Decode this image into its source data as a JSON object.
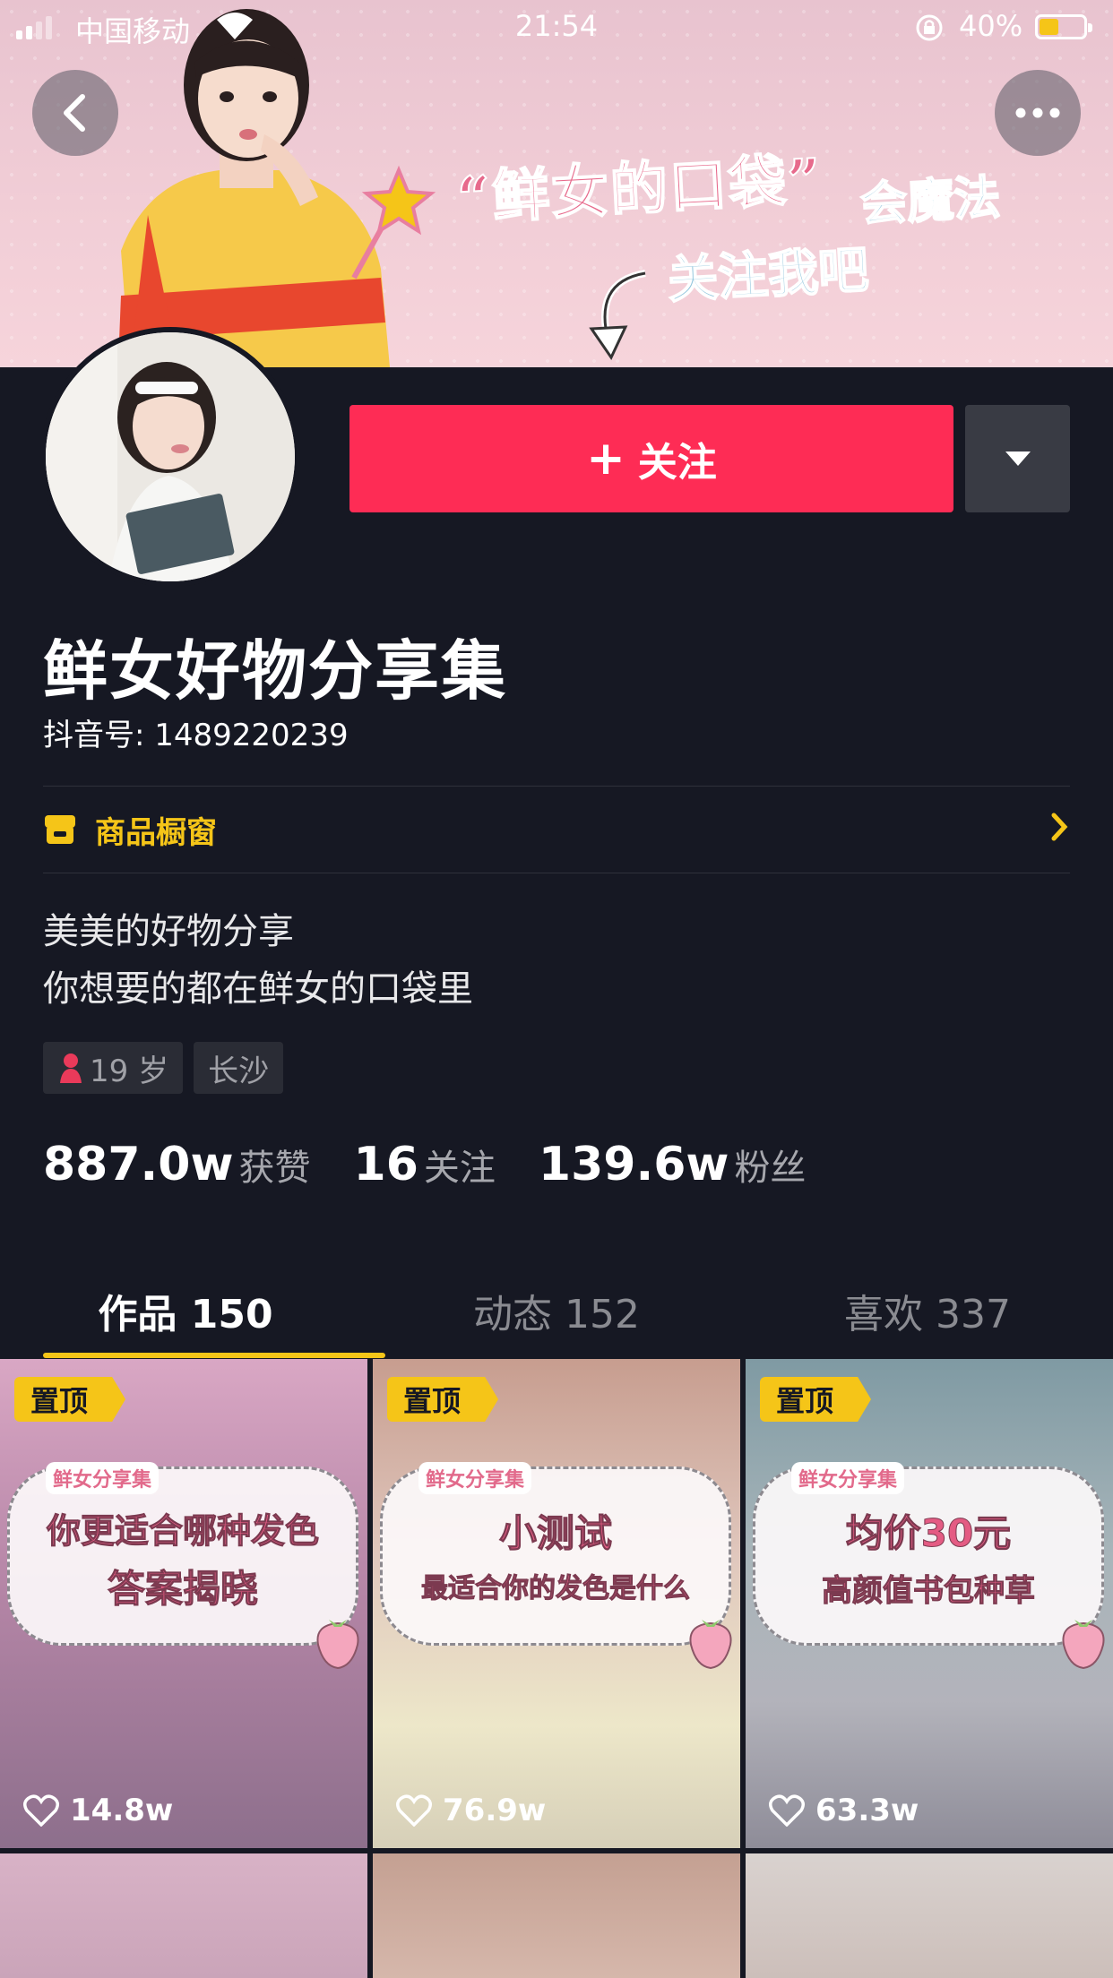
{
  "status_bar": {
    "carrier": "中国移动",
    "time": "21:54",
    "battery_percent": "40%",
    "battery_level": 0.4
  },
  "banner": {
    "headline": "“鲜女的口袋”",
    "headline_suffix": "会魔法",
    "call_to_action": "关注我吧"
  },
  "profile": {
    "follow_label": "关注",
    "name": "鲜女好物分享集",
    "douyin_id": "抖音号: 1489220239",
    "shop_label": "商品橱窗",
    "bio_line1": "美美的好物分享",
    "bio_line2": "你想要的都在鲜女的口袋里",
    "age_tag": "19 岁",
    "city_tag": "长沙",
    "likes_count": "887.0w",
    "likes_label": "获赞",
    "following_count": "16",
    "following_label": "关注",
    "followers_count": "139.6w",
    "followers_label": "粉丝"
  },
  "tabs": [
    {
      "label": "作品 150"
    },
    {
      "label": "动态 152"
    },
    {
      "label": "喜欢 337"
    }
  ],
  "videos": [
    {
      "pin": "置顶",
      "badge": "鲜女分享集",
      "title1": "你更适合哪种发色",
      "title2": "答案揭晓",
      "likes": "14.8w"
    },
    {
      "pin": "置顶",
      "badge": "鲜女分享集",
      "title1": "小测试",
      "title2": "最适合你的发色是什么",
      "likes": "76.9w"
    },
    {
      "pin": "置顶",
      "badge": "鲜女分享集",
      "title1": "均价30元",
      "title2": "高颜值书包种草",
      "likes": "63.3w"
    }
  ],
  "colors": {
    "background": "#161823",
    "follow": "#fe2c55",
    "accent_yellow": "#f5c518"
  }
}
